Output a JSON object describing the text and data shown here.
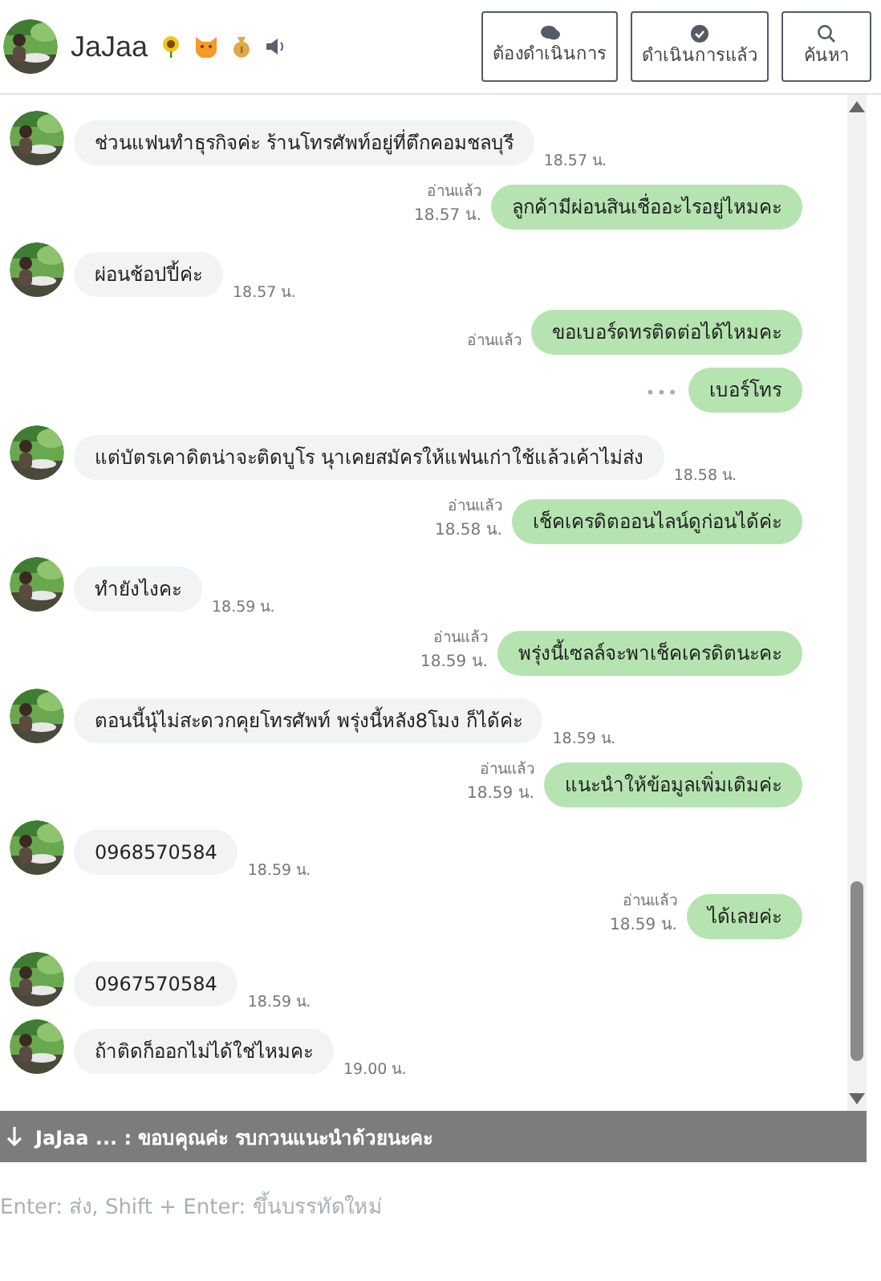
{
  "header": {
    "name": "JaJaa",
    "buttons": [
      {
        "kind": "pending",
        "label": "ต้องดำเนินการ"
      },
      {
        "kind": "done",
        "label": "ดำเนินการแล้ว"
      },
      {
        "kind": "search",
        "label": "ค้นหา"
      }
    ]
  },
  "messages": [
    {
      "kind": "in",
      "text": "ช่วนแฟนทำธุรกิจค่ะ ร้านโทรศัพท์อยู่ที่ตึกคอมชลบุรี",
      "time": "18.57 น."
    },
    {
      "kind": "out",
      "text": "ลูกค้ามีผ่อนสินเชื่ออะไรอยู่ไหมคะ",
      "read": "อ่านแล้ว",
      "time": "18.57 น."
    },
    {
      "kind": "in",
      "text": "ผ่อนช้อปปี้ค่ะ",
      "time": "18.57 น."
    },
    {
      "kind": "out",
      "text": "ขอเบอร์ดทรติดต่อได้ไหมคะ",
      "read": "อ่านแล้ว"
    },
    {
      "kind": "out",
      "text": "เบอร์โทร",
      "dots": "•••"
    },
    {
      "kind": "in",
      "text": "แต่บัตรเคาดิตน่าจะติดบูโร นุาเคยสมัครให้แฟนเก่าใช้แล้วเค้าไม่ส่ง",
      "time": "18.58 น."
    },
    {
      "kind": "out",
      "text": "เช็คเครดิตออนไลน์ดูก่อนได้ค่ะ",
      "read": "อ่านแล้ว",
      "time": "18.58 น."
    },
    {
      "kind": "in",
      "text": "ทำยังไงคะ",
      "time": "18.59 น."
    },
    {
      "kind": "out",
      "text": "พรุ่งนี้เซลล์จะพาเช็คเครดิตนะคะ",
      "read": "อ่านแล้ว",
      "time": "18.59 น."
    },
    {
      "kind": "in",
      "text": "ตอนนี้นุ๋ไม่สะดวกคุยโทรศัพท์ พรุ่งนี้หลัง8โมง ก็ได้ค่ะ",
      "time": "18.59 น."
    },
    {
      "kind": "out",
      "text": "แนะนำให้ข้อมูลเพิ่มเติมค่ะ",
      "read": "อ่านแล้ว",
      "time": "18.59 น."
    },
    {
      "kind": "in",
      "text": "0968570584",
      "time": "18.59 น."
    },
    {
      "kind": "out",
      "text": "ได้เลยค่ะ",
      "read": "อ่านแล้ว",
      "time": "18.59 น."
    },
    {
      "kind": "in",
      "text": "0967570584",
      "time": "18.59 น."
    },
    {
      "kind": "in",
      "text": "ถ้าติดก็ออกไม่ได้ใช่ไหมคะ",
      "time": "19.00 น."
    }
  ],
  "banner": {
    "text": "JaJaa ... : ขอบคุณค่ะ รบกวนแนะนำด้วยนะคะ"
  },
  "composer": {
    "placeholder": "Enter: ส่ง, Shift + Enter: ขึ้นบรรทัดใหม่"
  }
}
